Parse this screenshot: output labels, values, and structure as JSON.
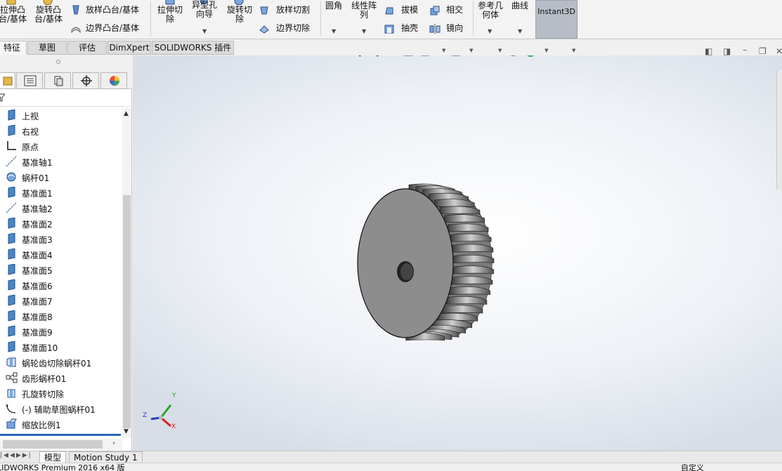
{
  "ribbon": {
    "extrude_boss": "拉伸凸\n台/基体",
    "revolve_boss": "旋转凸\n台/基体",
    "loft_boss": "放样凸台/基体",
    "boundary_boss": "边界凸台/基体",
    "extrude_cut": "拉伸切\n除",
    "hole_wizard": "异型孔\n向导",
    "revolve_cut": "旋转切\n除",
    "loft_cut": "放样切割",
    "boundary_cut": "边界切除",
    "fillet": "圆角",
    "linear_pattern": "线性阵\n列",
    "draft": "拔模",
    "shell": "抽壳",
    "intersect": "相交",
    "mirror": "镜向",
    "ref_geometry": "参考几\n何体",
    "curves": "曲线",
    "instant3d": "Instant3D"
  },
  "tabs": [
    {
      "label": "特征",
      "active": true
    },
    {
      "label": "草图",
      "active": false
    },
    {
      "label": "评估",
      "active": false
    },
    {
      "label": "DimXpert",
      "active": false
    },
    {
      "label": "SOLIDWORKS 插件",
      "active": false
    }
  ],
  "tree": [
    {
      "label": "上视",
      "icon": "plane-icon"
    },
    {
      "label": "右视",
      "icon": "plane-icon"
    },
    {
      "label": "原点",
      "icon": "origin-icon"
    },
    {
      "label": "基准轴1",
      "icon": "axis-icon"
    },
    {
      "label": "蜗杆01",
      "icon": "worm-feature-icon"
    },
    {
      "label": "基准面1",
      "icon": "plane-icon"
    },
    {
      "label": "基准轴2",
      "icon": "axis-icon"
    },
    {
      "label": "基准面2",
      "icon": "plane-icon"
    },
    {
      "label": "基准面3",
      "icon": "plane-icon"
    },
    {
      "label": "基准面4",
      "icon": "plane-icon"
    },
    {
      "label": "基准面5",
      "icon": "plane-icon"
    },
    {
      "label": "基准面6",
      "icon": "plane-icon"
    },
    {
      "label": "基准面7",
      "icon": "plane-icon"
    },
    {
      "label": "基准面8",
      "icon": "plane-icon"
    },
    {
      "label": "基准面9",
      "icon": "plane-icon"
    },
    {
      "label": "基准面10",
      "icon": "plane-icon"
    },
    {
      "label": "蜗轮齿切除蜗杆01",
      "icon": "cut-feature-icon"
    },
    {
      "label": "齿形蜗杆01",
      "icon": "pattern-feature-icon"
    },
    {
      "label": "孔旋转切除",
      "icon": "revolve-cut-icon"
    },
    {
      "label": "(-) 辅助草图蜗杆01",
      "icon": "sketch-icon"
    },
    {
      "label": "缩放比例1",
      "icon": "scale-icon"
    }
  ],
  "triad": {
    "x": "X",
    "y": "Y",
    "z": "Z"
  },
  "bottom_tabs": [
    {
      "label": "模型",
      "active": true
    },
    {
      "label": "Motion Study 1",
      "active": false
    }
  ],
  "status": {
    "left": "LIDWORKS Premium 2016 x64 版",
    "right": "自定义"
  },
  "colors": {
    "accent": "#2c66b8",
    "instant3d_bg": "#b7bdc7",
    "part_face": "#8c8c8c"
  }
}
